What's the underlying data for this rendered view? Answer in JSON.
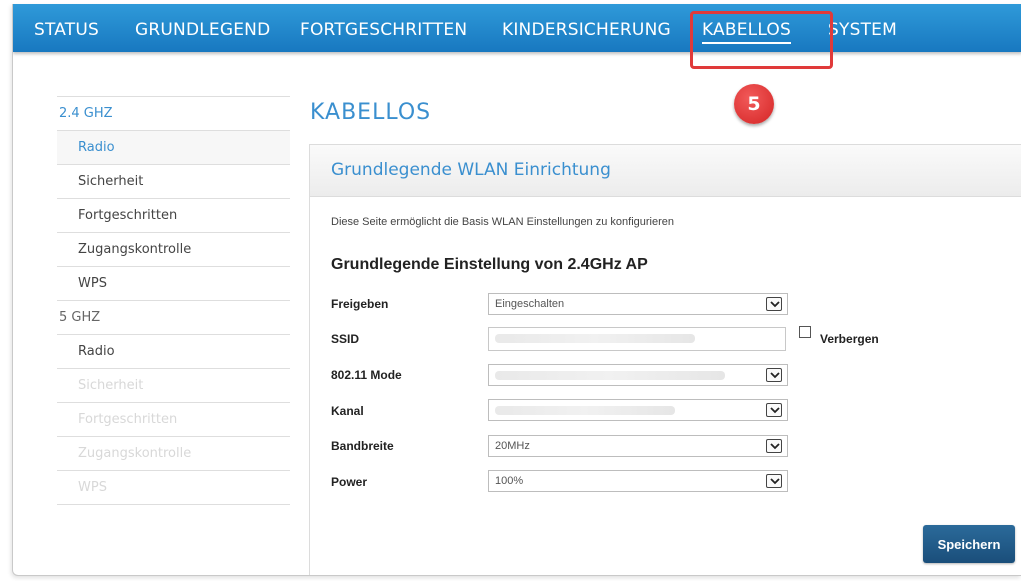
{
  "nav": {
    "items": [
      {
        "label": "STATUS"
      },
      {
        "label": "GRUNDLEGEND"
      },
      {
        "label": "FORTGESCHRITTEN"
      },
      {
        "label": "KINDERSICHERUNG"
      },
      {
        "label": "KABELLOS"
      },
      {
        "label": "SYSTEM"
      }
    ],
    "active": "KABELLOS"
  },
  "annotation": {
    "step": "5",
    "color": "#e03a3a"
  },
  "sidebar": {
    "groups": [
      {
        "header": "2.4 GHZ",
        "items": [
          "Radio",
          "Sicherheit",
          "Fortgeschritten",
          "Zugangskontrolle",
          "WPS"
        ]
      },
      {
        "header": "5 GHZ",
        "items": [
          "Radio",
          "Sicherheit",
          "Fortgeschritten",
          "Zugangskontrolle",
          "WPS"
        ]
      }
    ],
    "active_item": "Radio"
  },
  "page": {
    "title": "KABELLOS"
  },
  "panel": {
    "title": "Grundlegende WLAN Einrichtung",
    "description": "Diese Seite ermöglicht die Basis WLAN Einstellungen zu konfigurieren",
    "section_title": "Grundlegende Einstellung von 2.4GHz AP"
  },
  "form": {
    "freigeben": {
      "label": "Freigeben",
      "value": "Eingeschalten"
    },
    "ssid": {
      "label": "SSID",
      "value": ""
    },
    "hide": {
      "label": "Verbergen",
      "checked": false
    },
    "mode": {
      "label": "802.11 Mode",
      "value": ""
    },
    "kanal": {
      "label": "Kanal",
      "value": ""
    },
    "bandbreite": {
      "label": "Bandbreite",
      "value": "20MHz"
    },
    "power": {
      "label": "Power",
      "value": "100%"
    }
  },
  "buttons": {
    "save": "Speichern"
  },
  "colors": {
    "nav": "#1e86cc",
    "accent": "#3a8fcf",
    "save_button": "#1f5a88"
  }
}
